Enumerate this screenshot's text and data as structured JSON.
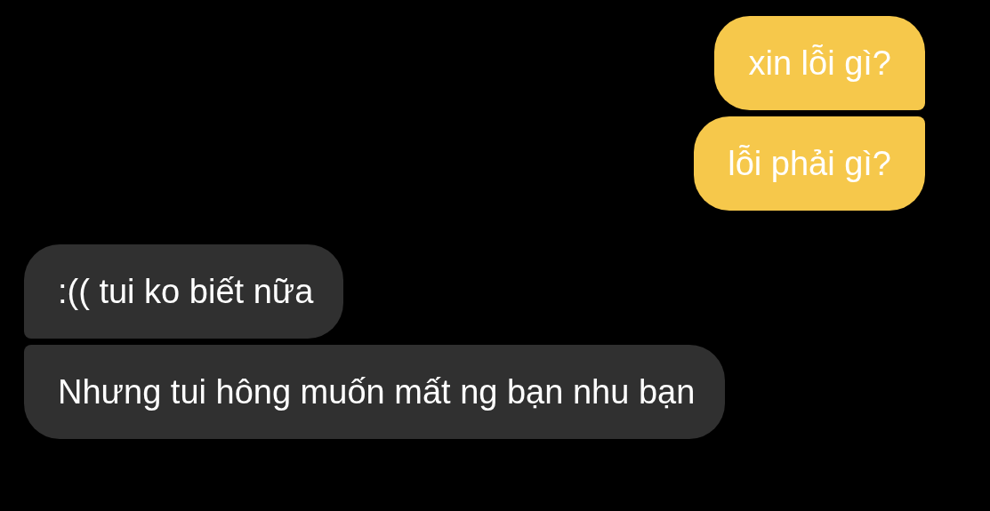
{
  "messages": [
    {
      "kind": "sent",
      "text": "xin lỗi gì?"
    },
    {
      "kind": "sent",
      "text": "lỗi phải gì?"
    },
    {
      "kind": "received",
      "text": ":(( tui ko biết nữa"
    },
    {
      "kind": "received",
      "text": "Nhưng tui hông muốn mất ng bạn nhu bạn"
    }
  ]
}
